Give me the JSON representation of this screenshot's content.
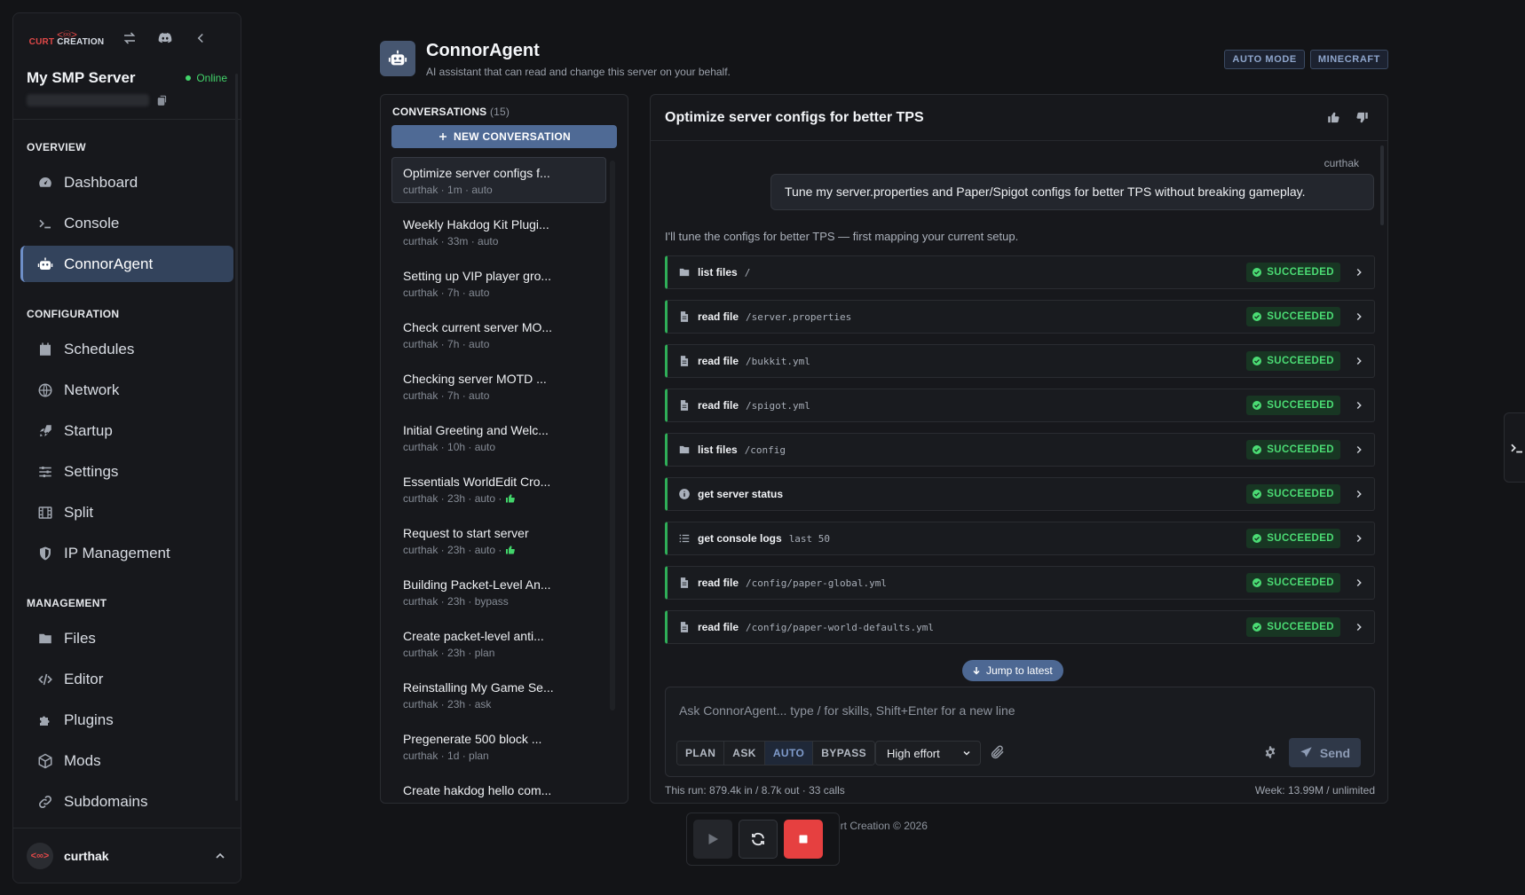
{
  "brand": {
    "logo_line1": "CURT",
    "logo_line2": "CREATION",
    "logo_mark": "<♾>"
  },
  "server": {
    "name": "My SMP Server",
    "status": "Online"
  },
  "sidebar": {
    "sections": [
      {
        "heading": "OVERVIEW",
        "items": [
          {
            "label": "Dashboard",
            "icon": "gauge-icon"
          },
          {
            "label": "Console",
            "icon": "terminal-icon"
          },
          {
            "label": "ConnorAgent",
            "icon": "robot-icon",
            "active": true
          }
        ]
      },
      {
        "heading": "CONFIGURATION",
        "items": [
          {
            "label": "Schedules",
            "icon": "calendar-icon"
          },
          {
            "label": "Network",
            "icon": "globe-icon"
          },
          {
            "label": "Startup",
            "icon": "rocket-icon"
          },
          {
            "label": "Settings",
            "icon": "sliders-icon"
          },
          {
            "label": "Split",
            "icon": "film-icon"
          },
          {
            "label": "IP Management",
            "icon": "shield-icon"
          }
        ]
      },
      {
        "heading": "MANAGEMENT",
        "items": [
          {
            "label": "Files",
            "icon": "folder-icon"
          },
          {
            "label": "Editor",
            "icon": "code-icon"
          },
          {
            "label": "Plugins",
            "icon": "puzzle-icon"
          },
          {
            "label": "Mods",
            "icon": "box-icon"
          },
          {
            "label": "Subdomains",
            "icon": "link-icon"
          }
        ]
      }
    ]
  },
  "user": {
    "name": "curthak"
  },
  "header": {
    "title": "ConnorAgent",
    "subtitle": "AI assistant that can read and change this server on your behalf.",
    "tags": [
      "AUTO MODE",
      "MINECRAFT"
    ]
  },
  "conversations": {
    "heading": "CONVERSATIONS",
    "count": "(15)",
    "new_label": "NEW CONVERSATION",
    "items": [
      {
        "title": "Optimize server configs f...",
        "meta": "curthak · 1m · auto",
        "active": true
      },
      {
        "title": "Weekly Hakdog Kit Plugi...",
        "meta": "curthak · 33m · auto"
      },
      {
        "title": "Setting up VIP player gro...",
        "meta": "curthak · 7h · auto"
      },
      {
        "title": "Check current server MO...",
        "meta": "curthak · 7h · auto"
      },
      {
        "title": "Checking server MOTD ...",
        "meta": "curthak · 7h · auto"
      },
      {
        "title": "Initial Greeting and Welc...",
        "meta": "curthak · 10h · auto"
      },
      {
        "title": "Essentials WorldEdit Cro...",
        "meta": "curthak · 23h · auto ·",
        "liked": true
      },
      {
        "title": "Request to start server",
        "meta": "curthak · 23h · auto ·",
        "liked": true
      },
      {
        "title": "Building Packet-Level An...",
        "meta": "curthak · 23h · bypass"
      },
      {
        "title": "Create packet-level anti...",
        "meta": "curthak · 23h · plan"
      },
      {
        "title": "Reinstalling My Game Se...",
        "meta": "curthak · 23h · ask"
      },
      {
        "title": "Pregenerate 500 block ...",
        "meta": "curthak · 1d · plan"
      },
      {
        "title": "Create hakdog hello com...",
        "meta": ""
      }
    ]
  },
  "chat": {
    "title": "Optimize server configs for better TPS",
    "user_label": "curthak",
    "user_message": "Tune my server.properties and Paper/Spigot configs for better TPS without breaking gameplay.",
    "assistant_message": "I'll tune the configs for better TPS — first mapping your current setup.",
    "tools": [
      {
        "name": "list files",
        "arg": "/",
        "icon": "folder-icon",
        "status": "SUCCEEDED"
      },
      {
        "name": "read file",
        "arg": "/server.properties",
        "icon": "file-icon",
        "status": "SUCCEEDED"
      },
      {
        "name": "read file",
        "arg": "/bukkit.yml",
        "icon": "file-icon",
        "status": "SUCCEEDED"
      },
      {
        "name": "read file",
        "arg": "/spigot.yml",
        "icon": "file-icon",
        "status": "SUCCEEDED"
      },
      {
        "name": "list files",
        "arg": "/config",
        "icon": "folder-icon",
        "status": "SUCCEEDED"
      },
      {
        "name": "get server status",
        "arg": "",
        "icon": "info-icon",
        "status": "SUCCEEDED"
      },
      {
        "name": "get console logs",
        "arg": "last 50",
        "icon": "list-icon",
        "status": "SUCCEEDED"
      },
      {
        "name": "read file",
        "arg": "/config/paper-global.yml",
        "icon": "file-icon",
        "status": "SUCCEEDED"
      },
      {
        "name": "read file",
        "arg": "/config/paper-world-defaults.yml",
        "icon": "file-icon",
        "status": "SUCCEEDED"
      }
    ],
    "jump_label": "Jump to latest"
  },
  "composer": {
    "placeholder": "Ask ConnorAgent... type / for skills, Shift+Enter for a new line",
    "modes": [
      "PLAN",
      "ASK",
      "AUTO",
      "BYPASS"
    ],
    "active_mode": "AUTO",
    "effort": "High effort",
    "send_label": "Send",
    "usage_run": "This run: 879.4k in / 8.7k out · 33 calls",
    "usage_week": "Week: 13.99M / unlimited"
  },
  "footer": {
    "text": "urt Creation © 2026"
  },
  "colors": {
    "accent": "#4f6a95",
    "success": "#4bdc74",
    "danger": "#e64040",
    "brand": "#e04848"
  }
}
